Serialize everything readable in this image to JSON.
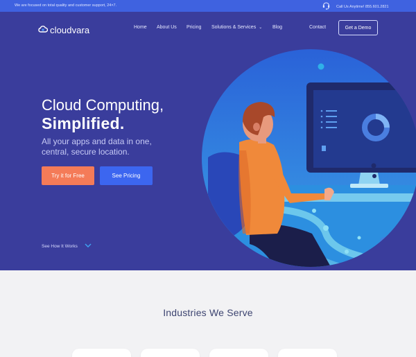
{
  "topbar": {
    "note": "We are focused on total quality and customer support, 24×7.",
    "phone": "Call Us Anytime! 855.601.2821"
  },
  "brand": {
    "name": "cloudvara"
  },
  "nav": {
    "items": [
      "Home",
      "About Us",
      "Pricing",
      "Solutions & Services",
      "Blog",
      "Contact"
    ],
    "cta": "Get a Demo"
  },
  "hero": {
    "title_line1": "Cloud Computing,",
    "title_line2": "Simplified.",
    "subtitle": "All your apps and data in one, central, secure location.",
    "primary_cta": "Try it for Free",
    "secondary_cta": "See Pricing",
    "scroll_link": "See How It Works"
  },
  "industries": {
    "title": "Industries We Serve"
  },
  "colors": {
    "hero_bg": "#3a3d9c",
    "topbar_bg": "#3f62e0",
    "accent_orange": "#f47b58",
    "accent_blue": "#3c66f0",
    "section_bg": "#f2f2f4"
  }
}
